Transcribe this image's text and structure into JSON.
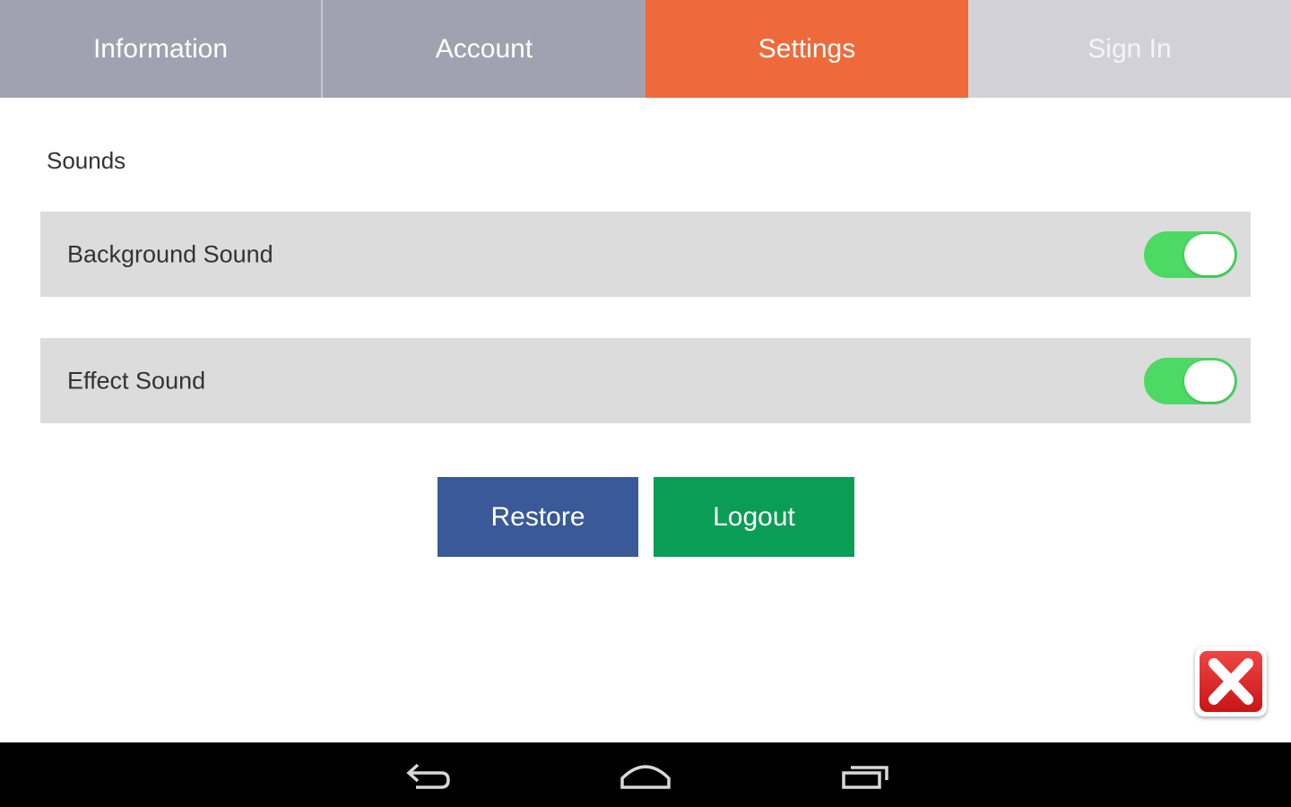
{
  "tabs": [
    {
      "label": "Information",
      "active": false
    },
    {
      "label": "Account",
      "active": false
    },
    {
      "label": "Settings",
      "active": true
    },
    {
      "label": "Sign In",
      "active": false
    }
  ],
  "settings": {
    "section_title": "Sounds",
    "rows": [
      {
        "label": "Background Sound",
        "enabled": true
      },
      {
        "label": "Effect Sound",
        "enabled": true
      }
    ]
  },
  "buttons": {
    "restore_label": "Restore",
    "logout_label": "Logout"
  },
  "close_button": {
    "icon": "close-icon"
  },
  "navbar": {
    "icons": [
      "back-icon",
      "home-icon",
      "recent-apps-icon"
    ]
  },
  "colors": {
    "tab_inactive": "#a2a1b1",
    "tab_active": "#ee6a3b",
    "tab_disabled": "#d2d1da",
    "toggle_on": "#4cd964",
    "restore_button": "#3a5998",
    "logout_button": "#0a9d55",
    "close_button": "#d91c1c"
  }
}
